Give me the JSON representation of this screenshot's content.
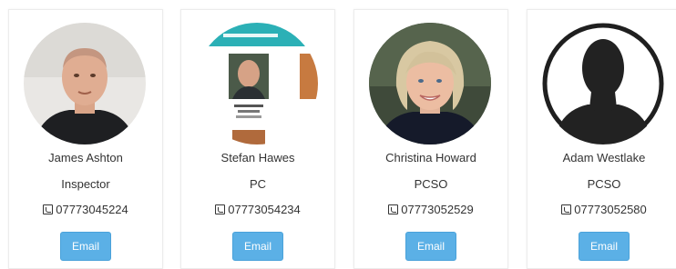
{
  "accent_color": "#5bb0e6",
  "members": [
    {
      "name": "James Ashton",
      "role": "Inspector",
      "phone": "07773045224",
      "email_label": "Email",
      "photo": "male-officer-photo"
    },
    {
      "name": "Stefan Hawes",
      "role": "PC",
      "phone": "07773054234",
      "email_label": "Email",
      "photo": "poster-photo"
    },
    {
      "name": "Christina Howard",
      "role": "PCSO",
      "phone": "07773052529",
      "email_label": "Email",
      "photo": "female-officer-photo"
    },
    {
      "name": "Adam Westlake",
      "role": "PCSO",
      "phone": "07773052580",
      "email_label": "Email",
      "photo": "silhouette-placeholder"
    }
  ]
}
